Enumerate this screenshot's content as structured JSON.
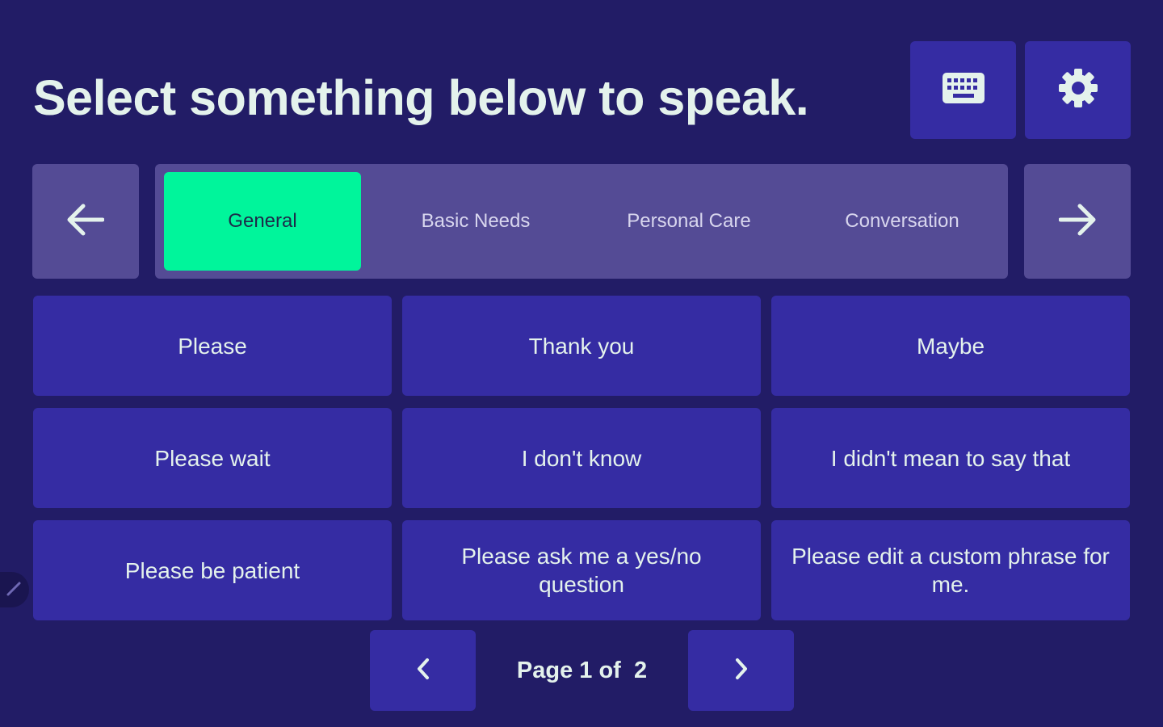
{
  "header": {
    "title": "Select something below to speak.",
    "keyboard_icon": "keyboard-icon",
    "settings_icon": "gear-icon"
  },
  "categories": {
    "prev_icon": "arrow-left-icon",
    "next_icon": "arrow-right-icon",
    "tabs": [
      {
        "label": "General",
        "active": true
      },
      {
        "label": "Basic Needs",
        "active": false
      },
      {
        "label": "Personal Care",
        "active": false
      },
      {
        "label": "Conversation",
        "active": false
      }
    ]
  },
  "phrases": [
    "Please",
    "Thank you",
    "Maybe",
    "Please wait",
    "I don't know",
    "I didn't mean to say that",
    "Please be patient",
    "Please ask me a yes/no question",
    "Please edit a custom phrase for me."
  ],
  "pagination": {
    "label": "Page 1 of  2",
    "prev_icon": "chevron-left-icon",
    "next_icon": "chevron-right-icon"
  },
  "colors": {
    "background": "#221c66",
    "button": "#352ca3",
    "strip": "#544b95",
    "active_tab": "#00f59b",
    "text": "#e4f2ec"
  }
}
